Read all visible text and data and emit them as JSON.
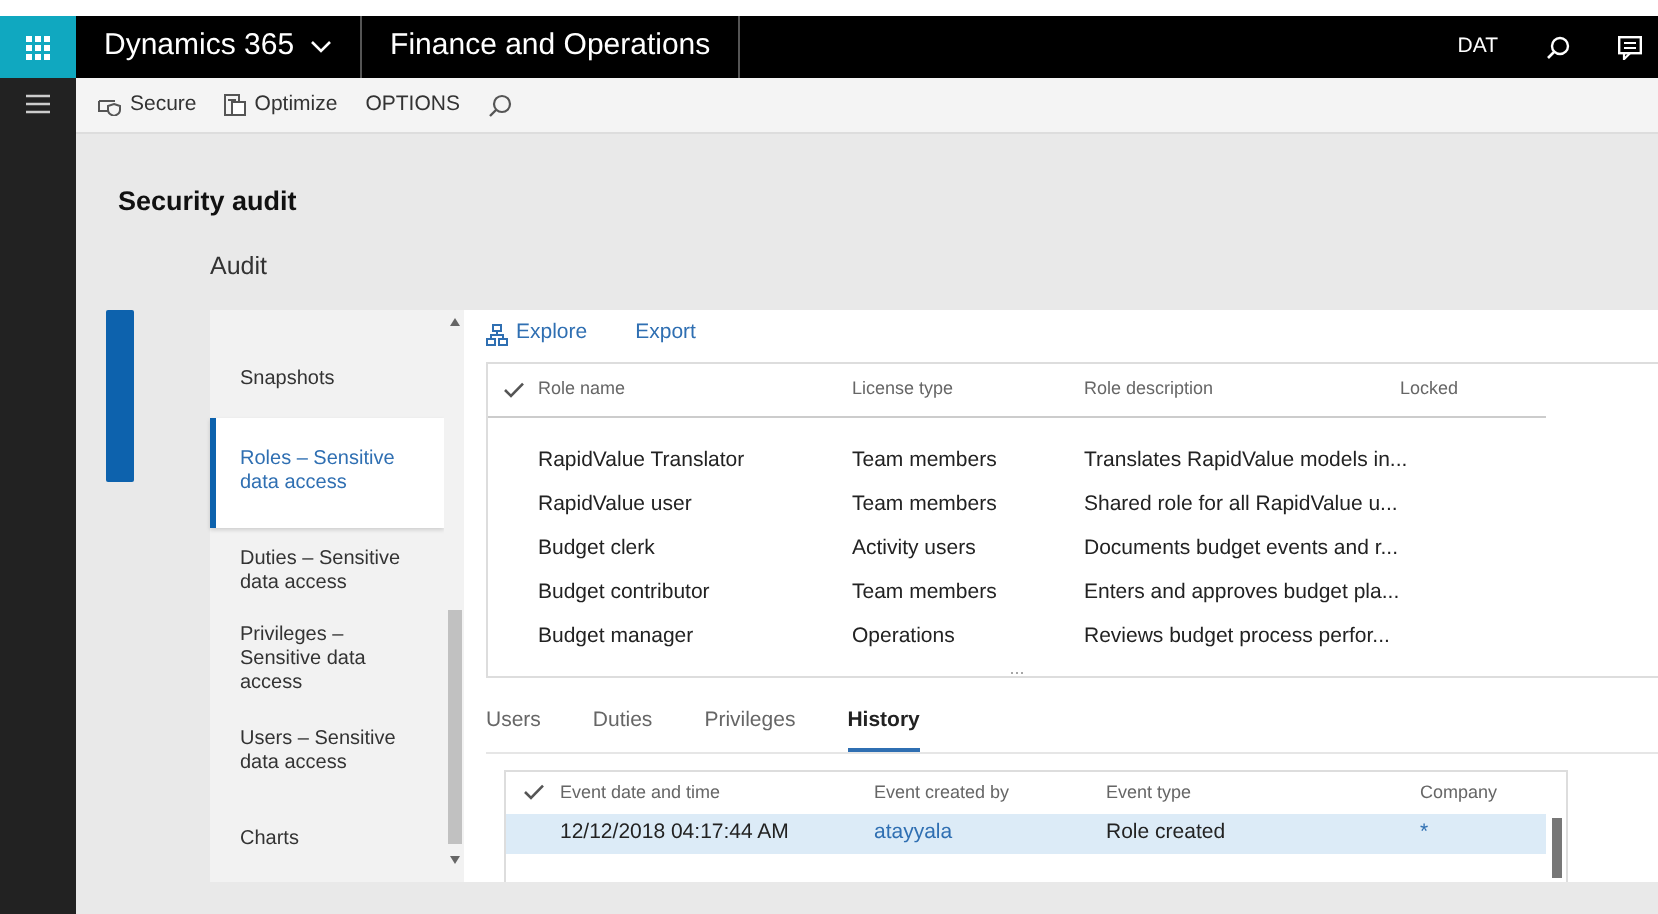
{
  "app": {
    "name": "Dynamics 365",
    "module": "Finance and Operations",
    "company": "DAT"
  },
  "toolbar": [
    {
      "kind": "secure",
      "label": "Secure"
    },
    {
      "kind": "optimize",
      "label": "Optimize"
    },
    {
      "kind": "text",
      "label": "OPTIONS"
    },
    {
      "kind": "search"
    }
  ],
  "page_title": "Security audit",
  "section": "Audit",
  "nav": [
    {
      "label": "Snapshots",
      "selected": false
    },
    {
      "label": "Roles – Sensitive data access",
      "selected": true
    },
    {
      "label": "Duties – Sensitive data access",
      "selected": false
    },
    {
      "label": "Privileges – Sensitive data access",
      "selected": false
    },
    {
      "label": "Users – Sensitive data access",
      "selected": false
    },
    {
      "label": "Charts",
      "selected": false
    }
  ],
  "actions": [
    {
      "kind": "explore",
      "label": "Explore"
    },
    {
      "kind": "plain",
      "label": "Export"
    }
  ],
  "roles": {
    "columns": [
      "Role name",
      "License type",
      "Role description",
      "Locked"
    ],
    "rows": [
      [
        "RapidValue Translator",
        "Team members",
        "Translates RapidValue models in..."
      ],
      [
        "RapidValue user",
        "Team members",
        "Shared role for all RapidValue u..."
      ],
      [
        "Budget clerk",
        "Activity users",
        "Documents budget events and r..."
      ],
      [
        "Budget contributor",
        "Team members",
        "Enters and approves budget pla..."
      ],
      [
        "Budget manager",
        "Operations",
        "Reviews budget process perfor..."
      ]
    ],
    "more": "..."
  },
  "tabs": [
    {
      "label": "Users",
      "selected": false
    },
    {
      "label": "Duties",
      "selected": false
    },
    {
      "label": "Privileges",
      "selected": false
    },
    {
      "label": "History",
      "selected": true
    }
  ],
  "history": {
    "columns": [
      "Event date and time",
      "Event created by",
      "Event type",
      "Company"
    ],
    "rows": [
      {
        "date": "12/12/2018 04:17:44 AM",
        "created_by": "atayyala",
        "type": "Role created",
        "company": "*",
        "selected": true
      }
    ]
  }
}
